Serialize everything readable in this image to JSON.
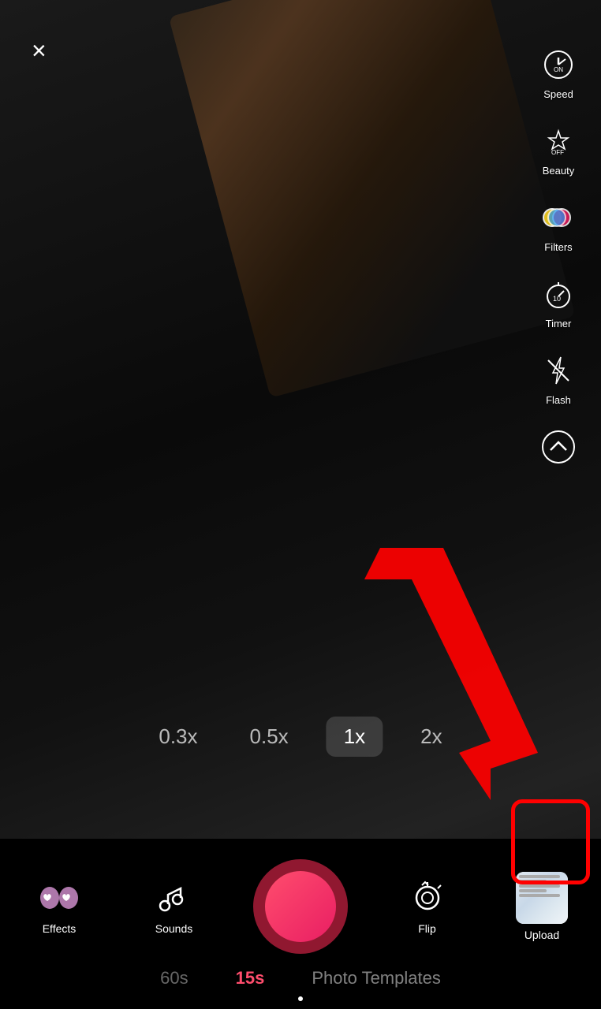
{
  "camera": {
    "close_label": "×"
  },
  "sidebar": {
    "items": [
      {
        "id": "speed",
        "label": "Speed",
        "icon": "speed-icon"
      },
      {
        "id": "beauty",
        "label": "Beauty",
        "icon": "beauty-icon"
      },
      {
        "id": "filters",
        "label": "Filters",
        "icon": "filters-icon"
      },
      {
        "id": "timer",
        "label": "Timer",
        "icon": "timer-icon"
      },
      {
        "id": "flash",
        "label": "Flash",
        "icon": "flash-icon"
      },
      {
        "id": "more",
        "label": "",
        "icon": "more-icon"
      }
    ]
  },
  "zoom": {
    "options": [
      {
        "label": "0.3x",
        "active": false
      },
      {
        "label": "0.5x",
        "active": false
      },
      {
        "label": "1x",
        "active": true
      },
      {
        "label": "2x",
        "active": false
      }
    ]
  },
  "controls": {
    "effects_label": "Effects",
    "sounds_label": "Sounds",
    "flip_label": "Flip",
    "upload_label": "Upload"
  },
  "duration_tabs": {
    "options": [
      {
        "label": "60s",
        "active": false
      },
      {
        "label": "15s",
        "active": true
      },
      {
        "label": "Photo Templates",
        "active": false
      }
    ]
  },
  "indicator": {
    "dot": "●"
  }
}
